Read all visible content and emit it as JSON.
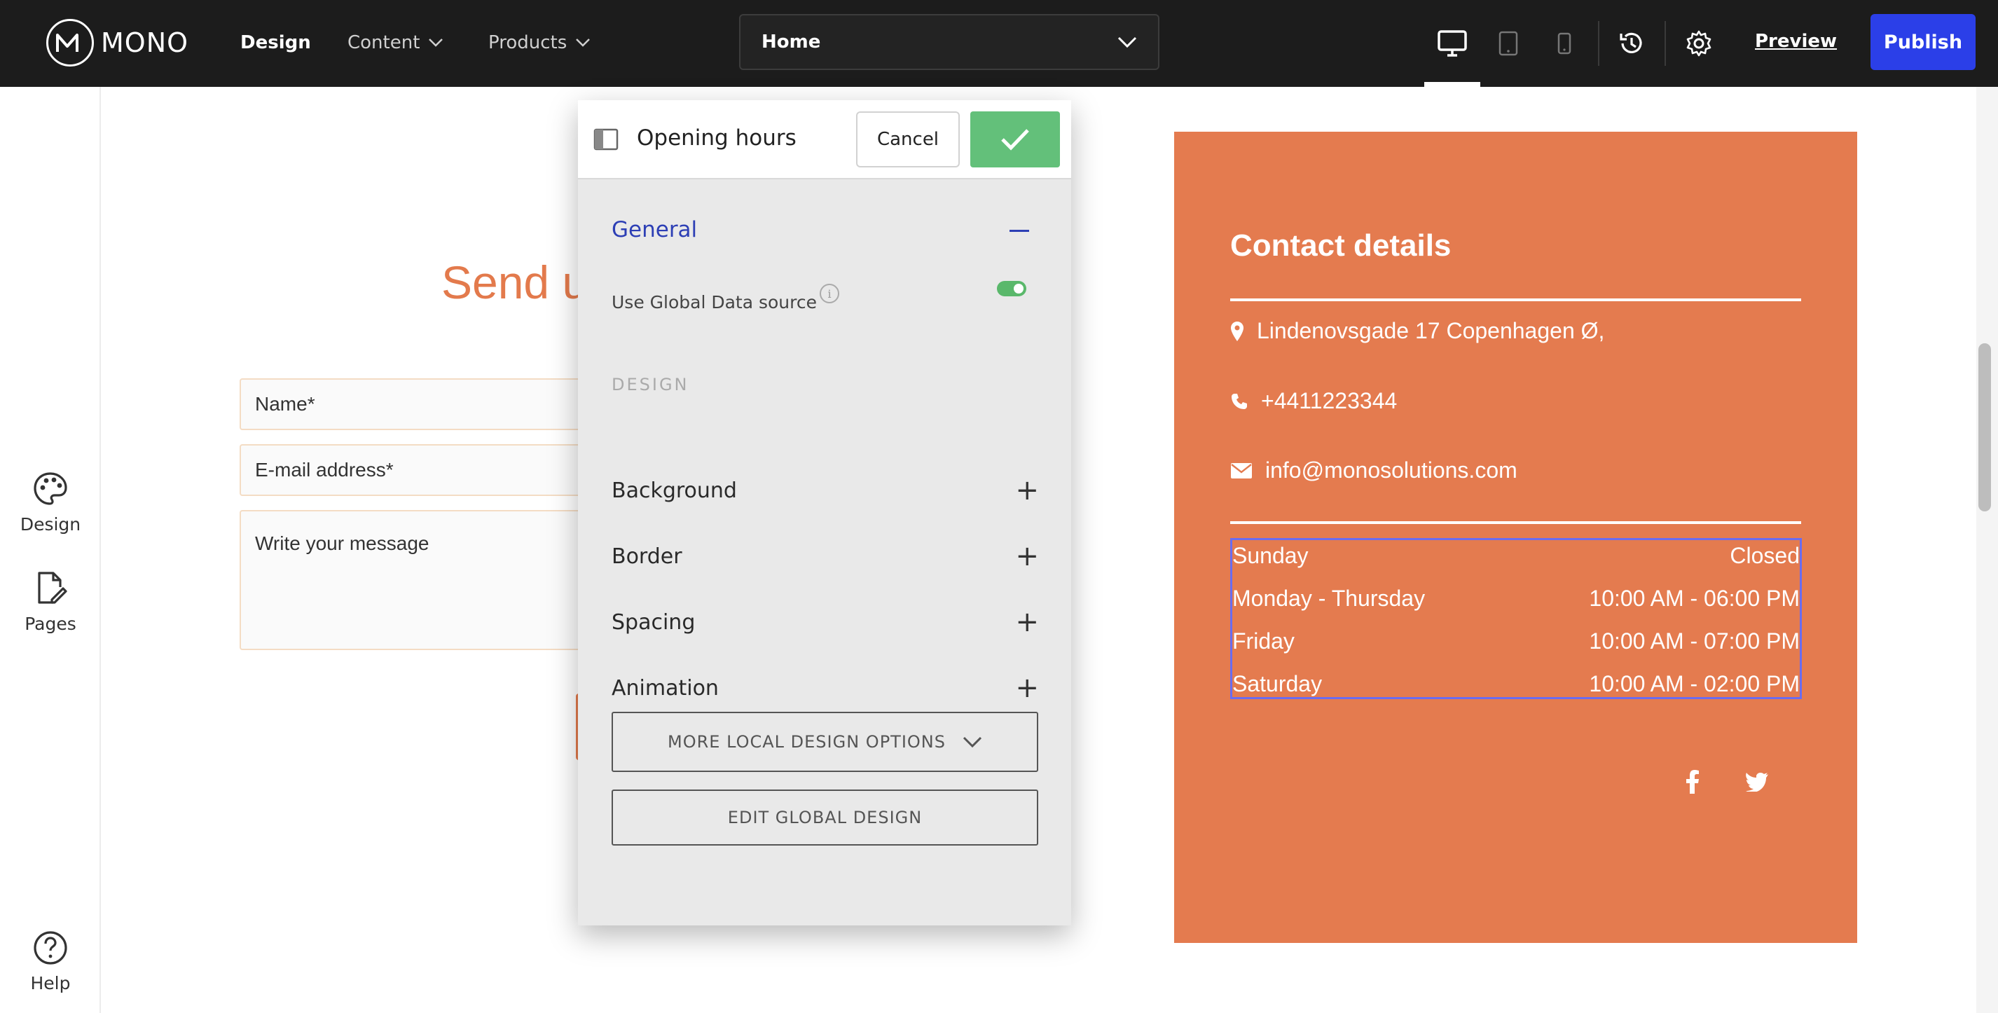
{
  "topbar": {
    "logo_text": "MONO",
    "nav": [
      {
        "label": "Design",
        "active": true
      },
      {
        "label": "Content",
        "has_dropdown": true
      },
      {
        "label": "Products",
        "has_dropdown": true
      }
    ],
    "page_select": {
      "value": "Home"
    },
    "device_modes": [
      "desktop-icon",
      "tablet-icon",
      "mobile-icon"
    ],
    "active_device": "desktop",
    "preview_label": "Preview",
    "publish_label": "Publish"
  },
  "sidebar": {
    "items": [
      {
        "label": "Design",
        "icon": "palette-icon"
      },
      {
        "label": "Pages",
        "icon": "page-edit-icon"
      }
    ],
    "help_label": "Help"
  },
  "form": {
    "heading_visible": "Send u",
    "name_placeholder": "Name*",
    "email_placeholder": "E-mail address*",
    "message_placeholder": "Write your message"
  },
  "contact": {
    "title": "Contact details",
    "address": "Lindenovsgade 17 Copenhagen Ø,",
    "phone": "+4411223344",
    "email": "info@monosolutions.com",
    "hours": [
      {
        "day": "Sunday",
        "time": "Closed"
      },
      {
        "day": "Monday - Thursday",
        "time": "10:00 AM - 06:00 PM"
      },
      {
        "day": "Friday",
        "time": "10:00 AM - 07:00 PM"
      },
      {
        "day": "Saturday",
        "time": "10:00 AM - 02:00 PM"
      }
    ],
    "social": [
      "facebook-icon",
      "twitter-icon"
    ],
    "card_color": "#e47b4f"
  },
  "panel": {
    "title": "Opening hours",
    "cancel_label": "Cancel",
    "general_label": "General",
    "global_data_label": "Use Global Data source",
    "global_data_on": true,
    "design_heading": "DESIGN",
    "sections": [
      "Background",
      "Border",
      "Spacing",
      "Animation"
    ],
    "more_options_label": "MORE LOCAL DESIGN OPTIONS",
    "edit_global_label": "EDIT GLOBAL DESIGN"
  },
  "colors": {
    "accent": "#e37a4c",
    "publish": "#2b3fe8",
    "confirm": "#63c07a",
    "general_link": "#2d3fb5",
    "selection": "#6a6cf0"
  }
}
